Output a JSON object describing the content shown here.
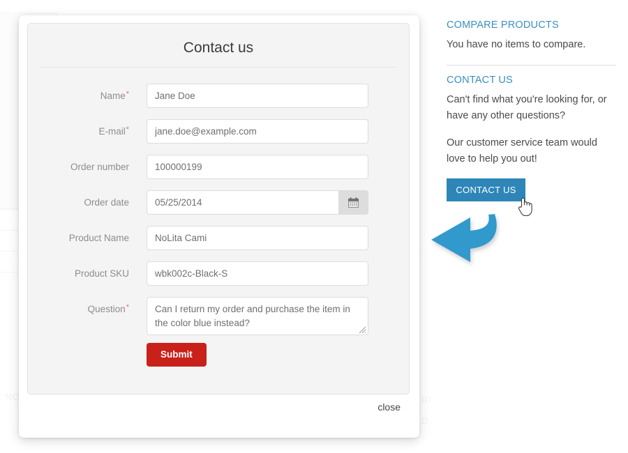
{
  "modal": {
    "title": "Contact us",
    "close_label": "close",
    "submit_label": "Submit",
    "calendar_icon": "calendar-icon",
    "fields": [
      {
        "label": "Name",
        "required": true,
        "value": "Jane Doe",
        "type": "text"
      },
      {
        "label": "E-mail",
        "required": true,
        "value": "jane.doe@example.com",
        "type": "text"
      },
      {
        "label": "Order number",
        "required": false,
        "value": "100000199",
        "type": "text"
      },
      {
        "label": "Order date",
        "required": false,
        "value": "05/25/2014",
        "type": "date"
      },
      {
        "label": "Product Name",
        "required": false,
        "value": "NoLita Cami",
        "type": "text"
      },
      {
        "label": "Product SKU",
        "required": false,
        "value": "wbk002c-Black-S",
        "type": "text"
      },
      {
        "label": "Question",
        "required": true,
        "value": "Can I return my order and purchase the item in the color blue instead?",
        "type": "textarea"
      }
    ]
  },
  "sidebar": {
    "compare_heading": "COMPARE PRODUCTS",
    "compare_text": "You have no items to compare.",
    "contact_heading": "CONTACT US",
    "contact_text_1": "Can't find what you're looking for, or have any other questions?",
    "contact_text_2": "Our customer service team would love to help you out!",
    "contact_button": "CONTACT US"
  },
  "annotations": {
    "arrow": "left-arrow-annotation",
    "cursor": "hand-cursor"
  },
  "colors": {
    "accent_blue": "#2e86b8",
    "heading_blue": "#3b8fc4",
    "submit_red": "#c9201a",
    "panel_gray": "#f4f4f4",
    "required_star": "#e8705a"
  }
}
